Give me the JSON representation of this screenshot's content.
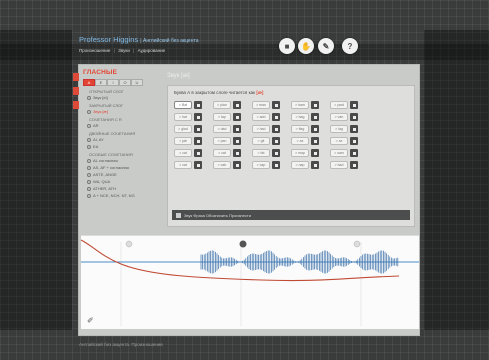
{
  "header": {
    "title": "Professor Higgins",
    "subtitle": "Английский без акцента",
    "nav": [
      "Произношение",
      "Звуки",
      "Аудирование"
    ]
  },
  "toolbar_buttons": [
    {
      "name": "camera-icon",
      "glyph": "◙"
    },
    {
      "name": "hand-icon",
      "glyph": "✋"
    },
    {
      "name": "pencil-icon",
      "glyph": "✎"
    },
    {
      "name": "help-icon",
      "glyph": "?"
    }
  ],
  "sidebar": {
    "title": "ГЛАСНЫЕ",
    "vowels": [
      "A",
      "E",
      "I",
      "O",
      "U"
    ],
    "active_vowel_index": 0,
    "menu": [
      {
        "type": "hdr",
        "text": "ОТКРЫТЫЙ СЛОГ"
      },
      {
        "type": "item",
        "text": "Звук [ei]"
      },
      {
        "type": "hdr",
        "text": "ЗАКРЫТЫЙ СЛОГ"
      },
      {
        "type": "item",
        "text": "Звук [æ]",
        "selected": true
      },
      {
        "type": "hdr",
        "text": "СОЧЕТАНИЯ С R"
      },
      {
        "type": "item",
        "text": "AR"
      },
      {
        "type": "hdr",
        "text": "ДВОЙНЫЕ СОЧЕТАНИЯ"
      },
      {
        "type": "item",
        "text": "AI, AY"
      },
      {
        "type": "item",
        "text": "EA"
      },
      {
        "type": "hdr",
        "text": "ОСОБЫЕ СОЧЕТАНИЯ"
      },
      {
        "type": "item",
        "text": "AL согласная"
      },
      {
        "type": "item",
        "text": "AS, AF + согласная"
      },
      {
        "type": "item",
        "text": "ASTE, ANGE"
      },
      {
        "type": "item",
        "text": "WA, QUA"
      },
      {
        "type": "item",
        "text": "ATHER, ATH"
      },
      {
        "type": "item",
        "text": "A + NCE, NCH, NT, NG"
      }
    ]
  },
  "panel": {
    "title": "Звук [æ]",
    "rule_prefix": "Буква А в закрытом слоге читается как",
    "rule_sound": "[æ]",
    "words": [
      [
        "> Bat",
        "> plan",
        "> man",
        "> ham",
        "> yard"
      ],
      [
        "> hat",
        "> tap",
        "> add",
        "> bag",
        "> van"
      ],
      [
        "> glad",
        "> dad",
        "> had",
        "> flag",
        "> lag"
      ],
      [
        "> jab",
        "> pan",
        "> git",
        "> ax",
        "> ax"
      ],
      [
        "> cat",
        "> cat",
        "> fat",
        "> map",
        "> sam"
      ],
      [
        "> cat",
        "> cab",
        "> cap",
        "> nap",
        "> bad"
      ]
    ],
    "selected_word": "> Bat",
    "footer_bar": "Звук   Фраза  Обозначить  Произнести"
  },
  "footer": {
    "text": "Английский без акцента. Произношение"
  }
}
